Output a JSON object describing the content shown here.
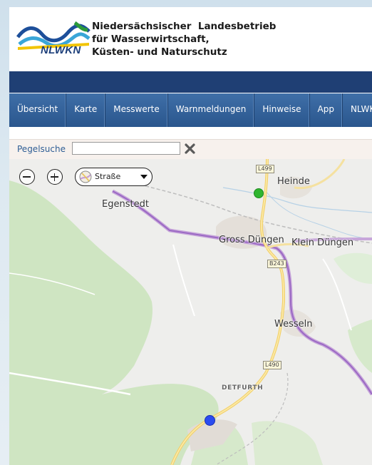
{
  "header": {
    "logo_text": "NLWKN",
    "org_lines": [
      "Niedersächsischer  Landesbetrieb",
      "für Wasserwirtschaft,",
      "Küsten- und Naturschutz"
    ]
  },
  "nav": {
    "items": [
      "Übersicht",
      "Karte",
      "Messwerte",
      "Warnmeldungen",
      "Hinweise",
      "App",
      "NLWKN"
    ]
  },
  "search": {
    "label": "Pegelsuche",
    "value": "",
    "clear_icon": "close-icon"
  },
  "map": {
    "layer_select": "Straße",
    "layer_icon": "globe-icon",
    "zoom_out_icon": "minus-circle-icon",
    "zoom_in_icon": "plus-circle-icon",
    "places": [
      "Heinde",
      "Egenstedt",
      "Gross Düngen",
      "Klein Düngen",
      "Wesseln",
      "DETFURTH"
    ],
    "road_shields": [
      "L499",
      "B243",
      "L490"
    ],
    "stations": [
      {
        "name": "green-station",
        "color": "#2fb52f"
      },
      {
        "name": "blue-station",
        "color": "#2b4cf0"
      }
    ]
  },
  "colors": {
    "nav_bg": "#2f5e95",
    "band": "#1f3f74",
    "link": "#2f5e95"
  }
}
